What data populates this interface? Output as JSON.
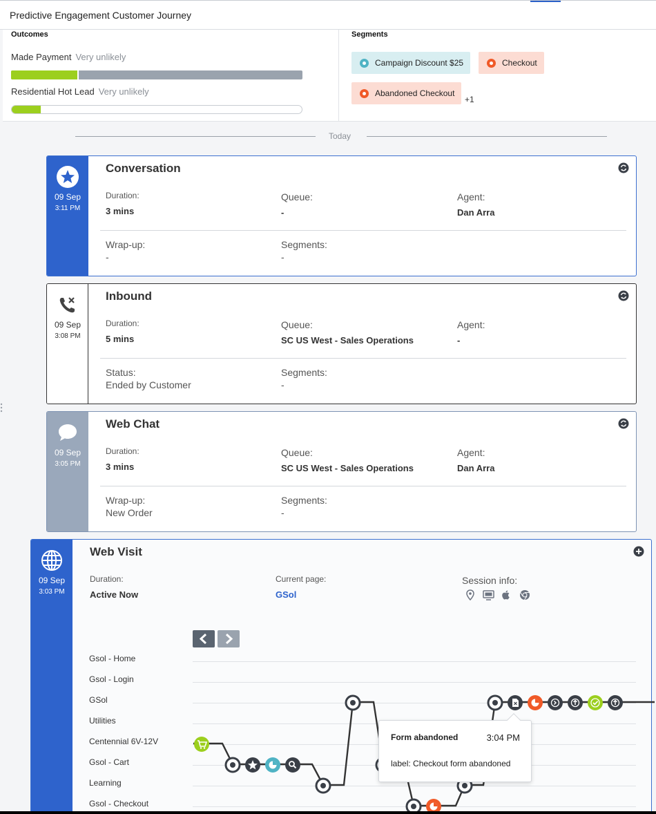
{
  "header": {
    "title": "Predictive Engagement Customer Journey"
  },
  "outcomes": {
    "title": "Outcomes",
    "items": [
      {
        "label": "Made Payment",
        "likelihood": "Very unlikely",
        "fill_fraction": 0.23
      },
      {
        "label": "Residential Hot Lead",
        "likelihood": "Very unlikely",
        "fill_fraction": 0.1
      }
    ]
  },
  "segments": {
    "title": "Segments",
    "chips": [
      {
        "label": "Campaign Discount $25",
        "color": "#4fb3c4"
      },
      {
        "label": "Checkout",
        "color": "#f05a28"
      },
      {
        "label": "Abandoned Checkout",
        "color": "#f05a28"
      }
    ],
    "more": "+1"
  },
  "timeline": {
    "divider": "Today",
    "cards": [
      {
        "type": "Conversation",
        "date": "09 Sep",
        "time": "3:11 PM",
        "icon": "star-icon",
        "duration_label": "Duration:",
        "duration": "3 mins",
        "queue_label": "Queue:",
        "queue": "-",
        "agent_label": "Agent:",
        "agent": "Dan Arra",
        "extra_label": "Wrap-up:",
        "extra": "-",
        "segments_label": "Segments:",
        "segments": "-"
      },
      {
        "type": "Inbound",
        "date": "09 Sep",
        "time": "3:08 PM",
        "icon": "phone-ended-icon",
        "duration_label": "Duration:",
        "duration": "5 mins",
        "queue_label": "Queue:",
        "queue": "SC US West - Sales Operations",
        "agent_label": "Agent:",
        "agent": "-",
        "extra_label": "Status:",
        "extra": "Ended by Customer",
        "segments_label": "Segments:",
        "segments": "-"
      },
      {
        "type": "Web Chat",
        "date": "09 Sep",
        "time": "3:05 PM",
        "icon": "chat-bubble-icon",
        "duration_label": "Duration:",
        "duration": "3 mins",
        "queue_label": "Queue:",
        "queue": "SC US West - Sales Operations",
        "agent_label": "Agent:",
        "agent": "Dan Arra",
        "extra_label": "Wrap-up:",
        "extra": "New Order",
        "segments_label": "Segments:",
        "segments": "-"
      }
    ],
    "web_visit": {
      "type": "Web Visit",
      "date": "09 Sep",
      "time": "3:03 PM",
      "icon": "globe-icon",
      "duration_label": "Duration:",
      "duration": "Active Now",
      "page_label": "Current page:",
      "page": "GSol",
      "session_label": "Session info:",
      "session_icons": [
        "location-pin-icon",
        "monitor-icon",
        "apple-icon",
        "chrome-icon"
      ],
      "pages": [
        "Gsol - Home",
        "Gsol - Login",
        "GSol",
        "Utilities",
        "Centennial 6V-12V",
        "Gsol - Cart",
        "Learning",
        "Gsol - Checkout"
      ],
      "tooltip": {
        "title": "Form abandoned",
        "time": "3:04 PM",
        "label": "label: Checkout form abandoned"
      }
    }
  }
}
